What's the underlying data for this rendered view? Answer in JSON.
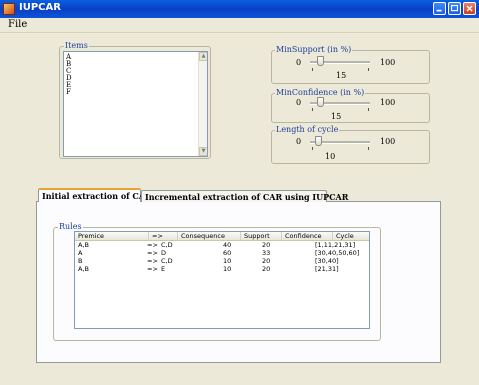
{
  "window": {
    "title": "IUPCAR"
  },
  "menu": {
    "file": "File"
  },
  "items": {
    "label": "Items",
    "list": [
      "A",
      "B",
      "C",
      "D",
      "E",
      "F"
    ]
  },
  "min_support": {
    "label": "MinSupport  (in %)",
    "min": "0",
    "max": "100",
    "value": "15"
  },
  "min_confidence": {
    "label": "MinConfidence  (in %)",
    "min": "0",
    "max": "100",
    "value": "15"
  },
  "cycle_length": {
    "label": "Length of cycle",
    "min": "0",
    "max": "100",
    "value": "10"
  },
  "tabs": [
    {
      "label": "Initial extraction of CAR",
      "active": true
    },
    {
      "label": "Incremental extraction of CAR using IUPCAR",
      "active": false
    }
  ],
  "rules": {
    "label": "Rules",
    "columns": [
      "Premice",
      "=>",
      "Consequence",
      "Support",
      "Confidence",
      "Cycle"
    ],
    "rows": [
      [
        "A,B",
        "=>",
        "C,D",
        "40",
        "20",
        "[1,11,21,31]"
      ],
      [
        "A",
        "=>",
        "D",
        "60",
        "33",
        "[30,40,50,60]"
      ],
      [
        "B",
        "=>",
        "C,D",
        "10",
        "20",
        "[30,40]"
      ],
      [
        "A,B",
        "=>",
        "E",
        "10",
        "20",
        "[21,31]"
      ]
    ]
  },
  "colors": {
    "titlebar": "#0a48d4",
    "group_label": "#1d3f9a",
    "window_bg": "#ece9d8"
  }
}
